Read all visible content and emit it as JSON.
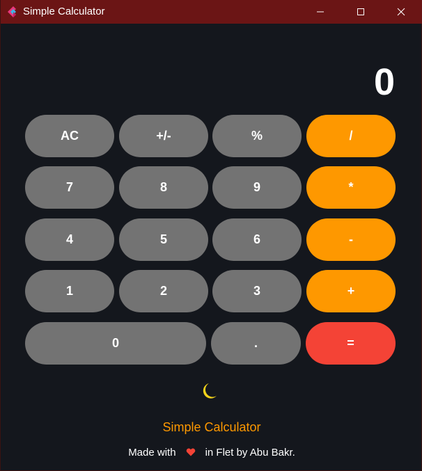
{
  "window": {
    "title": "Simple Calculator",
    "controls": {
      "minimize": "minimize-icon",
      "maximize": "maximize-icon",
      "close": "close-icon"
    }
  },
  "display": {
    "value": "0"
  },
  "keys": {
    "ac": "AC",
    "plus_minus": "+/-",
    "percent": "%",
    "divide": "/",
    "seven": "7",
    "eight": "8",
    "nine": "9",
    "multiply": "*",
    "four": "4",
    "five": "5",
    "six": "6",
    "minus": "-",
    "one": "1",
    "two": "2",
    "three": "3",
    "plus": "+",
    "zero": "0",
    "dot": ".",
    "equals": "="
  },
  "theme_toggle": {
    "icon": "moon-icon"
  },
  "footer": {
    "title": "Simple Calculator",
    "credit_prefix": "Made with",
    "credit_icon": "heart-icon",
    "credit_suffix": "in Flet by Abu Bakr."
  },
  "colors": {
    "background": "#14171d",
    "titlebar": "#6b1515",
    "digit_key": "#737373",
    "operator_key": "#fe9800",
    "equals_key": "#f44336",
    "footer_title": "#fe9800",
    "moon": "#f2d21b",
    "heart": "#f44336"
  }
}
